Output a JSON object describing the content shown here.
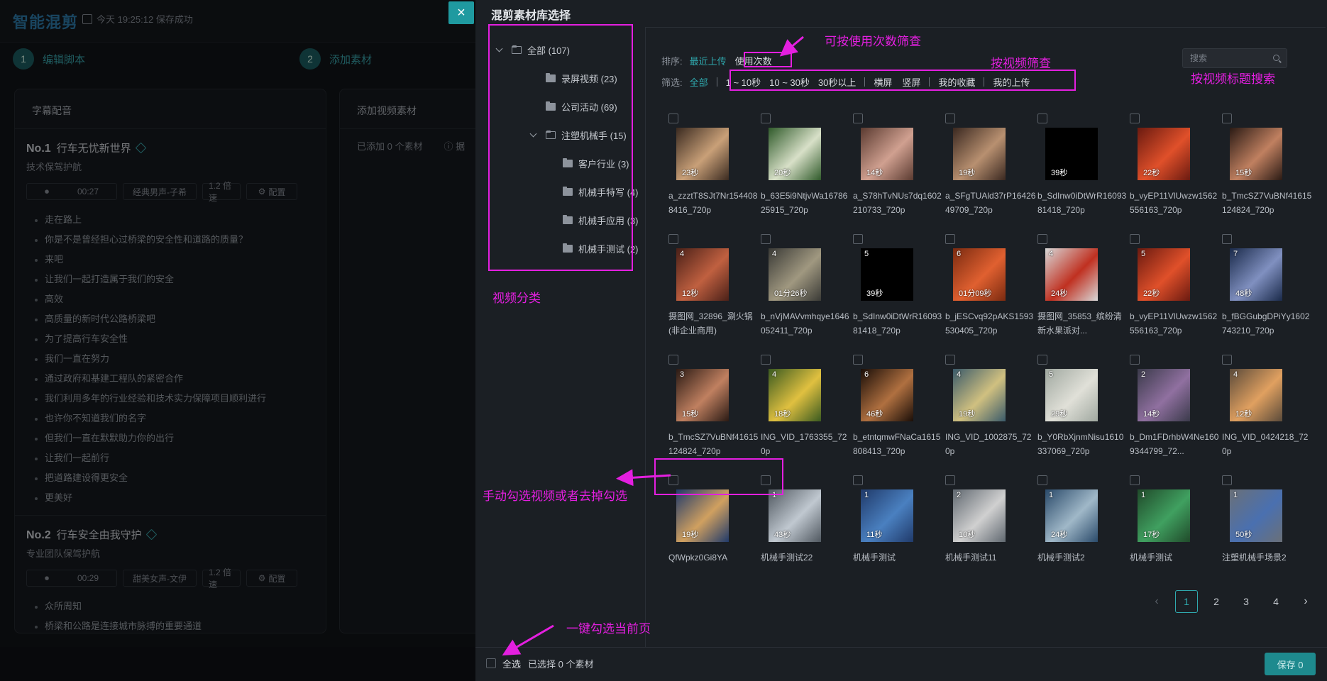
{
  "app": {
    "brand": "智能混剪",
    "save_status": "今天 19:25:12 保存成功",
    "steps": [
      {
        "num": "1",
        "label": "编辑脚本"
      },
      {
        "num": "2",
        "label": "添加素材"
      }
    ]
  },
  "left_card": {
    "title": "字幕配音",
    "sections": [
      {
        "no": "No.1",
        "title": "行车无忧新世界",
        "subtitle": "技术保驾护航",
        "duration": "00:27",
        "voice": "经典男声-子希",
        "speed": "1.2 倍速",
        "config": "配置",
        "lines": [
          "走在路上",
          "你是不是曾经担心过桥梁的安全性和道路的质量？",
          "来吧",
          "让我们一起打造属于我们的安全",
          "高效",
          "高质量的新时代公路桥梁吧",
          "为了提高行车安全性",
          "我们一直在努力",
          "通过政府和基建工程队的紧密合作",
          "我们利用多年的行业经验和技术实力保障项目顺利进行",
          "也许你不知道我们的名字",
          "但我们一直在默默助力你的出行",
          "让我们一起前行",
          "把道路建设得更安全",
          "更美好"
        ]
      },
      {
        "no": "No.2",
        "title": "行车安全由我守护",
        "subtitle": "专业团队保驾护航",
        "duration": "00:29",
        "voice": "甜美女声-文伊",
        "speed": "1.2 倍速",
        "config": "配置",
        "lines": [
          "众所周知",
          "桥梁和公路是连接城市脉搏的重要通道"
        ]
      }
    ]
  },
  "mid_card": {
    "title": "添加视频素材",
    "added": "已添加 0 个素材",
    "tip": "据"
  },
  "close_icon": "×",
  "drawer": {
    "title": "混剪素材库选择",
    "tree": [
      {
        "label": "全部 (107)",
        "level": 0,
        "open": true,
        "caret": true
      },
      {
        "label": "录屏视频 (23)",
        "level": 1
      },
      {
        "label": "公司活动 (69)",
        "level": 1
      },
      {
        "label": "注塑机械手 (15)",
        "level": 1,
        "open": true,
        "caret": true
      },
      {
        "label": "客户行业 (3)",
        "level": 2
      },
      {
        "label": "机械手特写 (4)",
        "level": 2
      },
      {
        "label": "机械手应用 (3)",
        "level": 2
      },
      {
        "label": "机械手测试 (2)",
        "level": 2
      }
    ],
    "sort": {
      "label": "排序:",
      "options": [
        "最近上传",
        "使用次数"
      ]
    },
    "filter": {
      "label": "筛选:",
      "all": "全部",
      "durations": [
        "1 ~ 10秒",
        "10 ~ 30秒",
        "30秒以上"
      ],
      "orientation": [
        "横屏",
        "竖屏"
      ],
      "favorites": "我的收藏",
      "uploads": "我的上传"
    },
    "search_placeholder": "搜索",
    "tiles": [
      {
        "name": "a_zzztT8SJt7Nr1544088416_720p",
        "dur": "23秒",
        "count": "",
        "color": "#3a2a20",
        "accent": "#c9a078"
      },
      {
        "name": "b_63E5i9NtjvWa1678625915_720p",
        "dur": "20秒",
        "count": "",
        "color": "#2f5a2a",
        "accent": "#d8e0c8"
      },
      {
        "name": "a_S78hTvNUs7dq1602210733_720p",
        "dur": "14秒",
        "count": "",
        "color": "#5a3a30",
        "accent": "#d0a090"
      },
      {
        "name": "a_SFgTUAld37rP1642649709_720p",
        "dur": "19秒",
        "count": "",
        "color": "#3a2820",
        "accent": "#b89070"
      },
      {
        "name": "b_SdInw0iDtWrR1609381418_720p",
        "dur": "39秒",
        "count": "",
        "color": "#000000",
        "accent": "#000000"
      },
      {
        "name": "b_vyEP11VlUwzw1562556163_720p",
        "dur": "22秒",
        "count": "",
        "color": "#6a1a10",
        "accent": "#e0502a"
      },
      {
        "name": "b_TmcSZ7VuBNf41615124824_720p",
        "dur": "15秒",
        "count": "",
        "color": "#2a1a14",
        "accent": "#c08060"
      },
      {
        "name": "摄图网_32896_涮火锅(非企业商用)",
        "dur": "12秒",
        "count": "4",
        "color": "#4a2018",
        "accent": "#c06040"
      },
      {
        "name": "b_nVjMAVvmhqye1646052411_720p",
        "dur": "01分26秒",
        "count": "4",
        "color": "#3a3a36",
        "accent": "#a09880"
      },
      {
        "name": "b_SdInw0iDtWrR1609381418_720p",
        "dur": "39秒",
        "count": "5",
        "color": "#000000",
        "accent": "#000000"
      },
      {
        "name": "b_jESCvq92pAKS1593530405_720p",
        "dur": "01分09秒",
        "count": "6",
        "color": "#7a2a10",
        "accent": "#e06030"
      },
      {
        "name": "摄图网_35853_缤纷清新水果派对...",
        "dur": "24秒",
        "count": "4",
        "color": "#d8d8d8",
        "accent": "#c03020"
      },
      {
        "name": "b_vyEP11VlUwzw1562556163_720p",
        "dur": "22秒",
        "count": "5",
        "color": "#6a1a10",
        "accent": "#e0502a"
      },
      {
        "name": "b_fBGGubgDPiYy1602743210_720p",
        "dur": "48秒",
        "count": "7",
        "color": "#1a2a4a",
        "accent": "#8090c0"
      },
      {
        "name": "b_TmcSZ7VuBNf41615124824_720p",
        "dur": "15秒",
        "count": "3",
        "color": "#2a1a14",
        "accent": "#c08060"
      },
      {
        "name": "ING_VID_1763355_720p",
        "dur": "18秒",
        "count": "4",
        "color": "#3a5a20",
        "accent": "#e0c040"
      },
      {
        "name": "b_etntqmwFNaCa1615808413_720p",
        "dur": "46秒",
        "count": "6",
        "color": "#1a0e08",
        "accent": "#b07040"
      },
      {
        "name": "ING_VID_1002875_720p",
        "dur": "19秒",
        "count": "4",
        "color": "#3a5a6a",
        "accent": "#d0c080"
      },
      {
        "name": "b_Y0RbXjnmNisu1610337069_720p",
        "dur": "29秒",
        "count": "5",
        "color": "#a0a8a0",
        "accent": "#e0e0d8"
      },
      {
        "name": "b_Dm1FDrhbW4Ne1609344799_72...",
        "dur": "14秒",
        "count": "2",
        "color": "#3a3a4a",
        "accent": "#9070a0"
      },
      {
        "name": "ING_VID_0424218_720p",
        "dur": "12秒",
        "count": "4",
        "color": "#5a4a3a",
        "accent": "#e0a060"
      },
      {
        "name": "QfWpkz0Gi8YA",
        "dur": "19秒",
        "count": "",
        "color": "#203a6a",
        "accent": "#d0a060"
      },
      {
        "name": "机械手测试22",
        "dur": "43秒",
        "count": "1",
        "color": "#505860",
        "accent": "#c0c8d0"
      },
      {
        "name": "机械手测试",
        "dur": "11秒",
        "count": "1",
        "color": "#203a6a",
        "accent": "#4a80c0"
      },
      {
        "name": "机械手测试11",
        "dur": "10秒",
        "count": "2",
        "color": "#606870",
        "accent": "#d0d0d0"
      },
      {
        "name": "机械手测试2",
        "dur": "24秒",
        "count": "1",
        "color": "#2a4a6a",
        "accent": "#a0b8c8"
      },
      {
        "name": "机械手测试",
        "dur": "17秒",
        "count": "1",
        "color": "#204a2a",
        "accent": "#40a060"
      },
      {
        "name": "注塑机械手场景2",
        "dur": "50秒",
        "count": "1",
        "color": "#6a7078",
        "accent": "#4a70b0"
      }
    ],
    "pagination": {
      "prev": "‹",
      "pages": [
        "1",
        "2",
        "3",
        "4"
      ],
      "current": "1",
      "next": "›"
    },
    "footer": {
      "select_all": "全选",
      "selected": "已选择 0 个素材",
      "save": "保存 0"
    }
  },
  "annotations": {
    "sort_by_usage": "可按使用次数筛查",
    "filter_by_video": "按视频筛查",
    "search_by_title": "按视频标题搜索",
    "video_category": "视频分类",
    "manual_check": "手动勾选视频或者去掉勾选",
    "select_page": "一键勾选当前页"
  },
  "colors": {
    "accent": "#2fa9ae",
    "annotation": "#e41fe0",
    "drawer_bg": "#1b1f24"
  }
}
